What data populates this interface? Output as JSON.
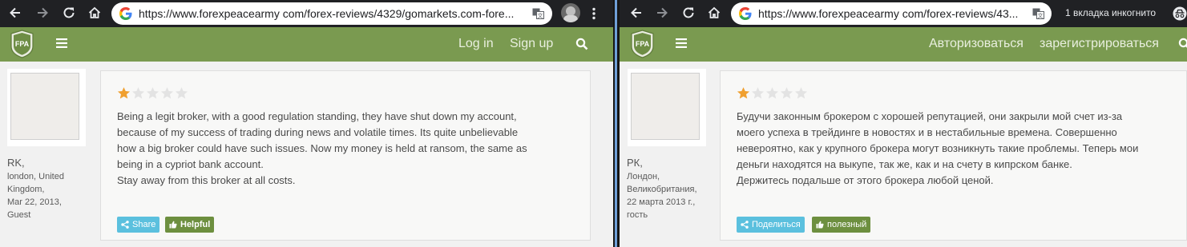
{
  "left": {
    "browser": {
      "url": "https://www.forexpeacearmy com/forex-reviews/4329/gomarkets.com-fore..."
    },
    "header": {
      "logo_text": "FPA",
      "login_label": "Log in",
      "signup_label": "Sign up"
    },
    "review": {
      "rating": 1,
      "max_rating": 5,
      "author_name": "RK,",
      "author_meta": "london, United\nKingdom,\nMar 22, 2013,\nGuest",
      "text": "Being a legit broker, with a good regulation standing, they have shut down my account,\nbecause of my success of trading during news and volatile times. Its quite unbelievable\nhow a big broker could have such issues. Now my money is held at ransom, the same as\nbeing in a cypriot bank account.\nStay away from this broker at all costs.",
      "share_label": "Share",
      "helpful_label": "Helpful"
    }
  },
  "right": {
    "browser": {
      "url": "https://www.forexpeacearmy com/forex-reviews/43...",
      "incognito_label": "1 вкладка инкогнито"
    },
    "header": {
      "logo_text": "FPA",
      "login_label": "Авторизоваться",
      "signup_label": "зарегистрироваться"
    },
    "review": {
      "rating": 1,
      "max_rating": 5,
      "author_name": "РК,",
      "author_meta": "Лондон,\nВеликобритания,\n22 марта 2013 г.,\nгость",
      "text": "Будучи законным брокером с хорошей репутацией, они закрыли мой счет из-за\nмоего успеха в трейдинге в новостях и в нестабильные времена. Совершенно\nневероятно, как у крупного брокера могут возникнуть такие проблемы. Теперь мои\nденьги находятся на выкупе, так же, как и на счету в кипрском банке.\nДержитесь подальше от этого брокера любой ценой.",
      "share_label": "Поделиться",
      "helpful_label": "полезный"
    }
  },
  "colors": {
    "header_green": "#7a9a50",
    "star_filled": "#f0a030",
    "star_empty": "#e3e3e3",
    "share_blue": "#5bc0de",
    "helpful_green": "#6d8f3f",
    "chrome_dark": "#202124"
  },
  "icons": {
    "back": "arrow-left-icon",
    "forward": "arrow-right-icon",
    "reload": "reload-icon",
    "home": "home-icon",
    "google": "google-g-icon",
    "translate": "translate-icon",
    "menu": "hamburger-menu-icon",
    "search": "search-icon",
    "share": "share-icon",
    "thumbs_up": "thumbs-up-icon",
    "incognito": "incognito-icon",
    "kebab": "kebab-menu-icon"
  }
}
